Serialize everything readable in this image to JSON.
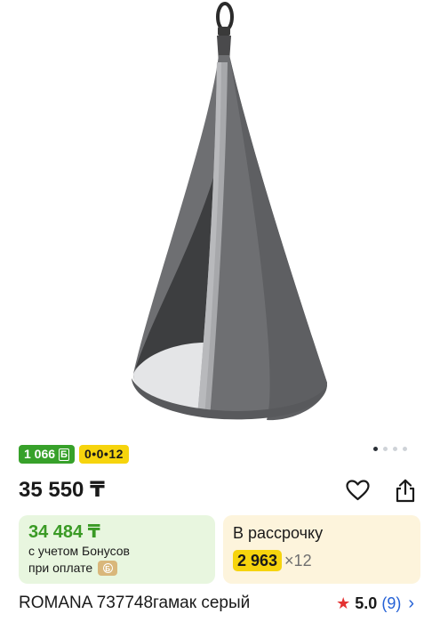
{
  "badges": {
    "bonus_amount": "1 066",
    "bonus_symbol": "Б",
    "installment_label": "0•0•12"
  },
  "price": "35 550 ₸",
  "bonus_card": {
    "price": "34 484 ₸",
    "line1": "с учетом Бонусов",
    "line2": "при оплате"
  },
  "installment_card": {
    "title": "В рассрочку",
    "amount": "2 963",
    "months": "×12"
  },
  "product": {
    "title": "ROMANA 737748гамак серый",
    "rating": "5.0",
    "reviews": "(9)"
  },
  "gallery": {
    "dots": 4,
    "active_index": 0
  },
  "icons": {
    "favorite": "heart-icon",
    "share": "share-icon",
    "star": "star-icon",
    "chevron": "chevron-right-icon",
    "coin": "bonus-coin-icon"
  },
  "colors": {
    "bonus_green": "#37a12a",
    "installment_yellow": "#f6d40d",
    "bonus_card_bg": "#e8f6df",
    "installment_card_bg": "#fdf4dc",
    "rating_star": "#e43232",
    "link_blue": "#2461d6"
  }
}
